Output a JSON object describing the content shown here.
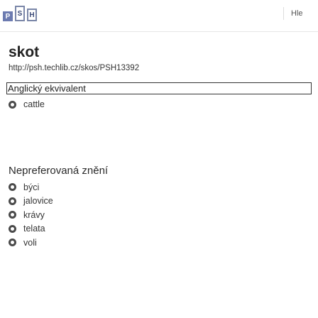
{
  "header": {
    "logo_letters": [
      "P",
      "S",
      "H"
    ],
    "search_hint": "Hle"
  },
  "term": {
    "title": "skot",
    "uri": "http://psh.techlib.cz/skos/PSH13392"
  },
  "english_equivalent": {
    "heading": "Anglický ekvivalent",
    "items": [
      "cattle"
    ]
  },
  "alternative_labels": {
    "heading": "Nepreferovaná znění",
    "items": [
      "býci",
      "jalovice",
      "krávy",
      "telata",
      "voli"
    ]
  }
}
